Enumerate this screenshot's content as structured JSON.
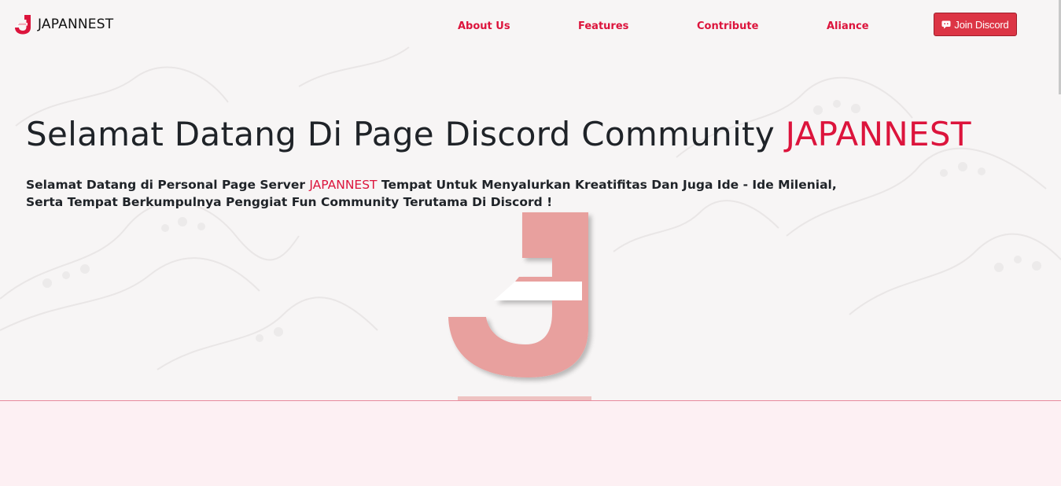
{
  "colors": {
    "accent": "#dc143c",
    "button": "#dc3545",
    "logo_pink": "#e8a09e",
    "heading": "#1f2328",
    "footer_bg": "#fdf0f3"
  },
  "brand": {
    "name": "JAPANNEST",
    "icon": "japannest-logo-icon"
  },
  "nav": {
    "links": [
      {
        "label": "About Us"
      },
      {
        "label": "Features"
      },
      {
        "label": "Contribute"
      },
      {
        "label": "Aliance"
      }
    ],
    "cta": {
      "label": "Join Discord",
      "icon": "discord-icon"
    }
  },
  "hero": {
    "title_prefix": "Selamat Datang Di Page Discord Community ",
    "title_accent": "JAPANNEST",
    "subtitle_part1": "Selamat Datang di Personal Page Server ",
    "subtitle_accent": "JAPANNEST",
    "subtitle_part2": " Tempat Untuk Menyalurkan Kreatifitas Dan Juga Ide - Ide Milenial,",
    "subtitle_line2": "Serta Tempat Berkumpulnya Penggiat Fun Community Terutama Di Discord !",
    "logo_icon": "japannest-big-logo"
  }
}
